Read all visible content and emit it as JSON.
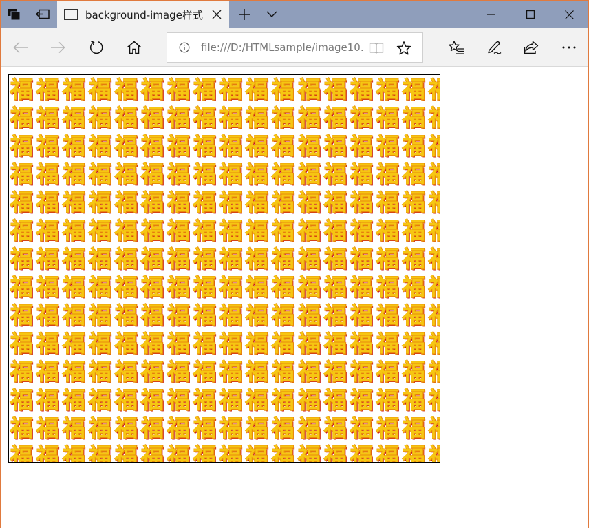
{
  "browser": {
    "tab_title": "background-image样式",
    "address": "file:///D:/HTMLsample/image10.",
    "buttons": {
      "back": "arrow-left-icon",
      "forward": "arrow-right-icon",
      "refresh": "refresh-icon",
      "home": "home-icon",
      "reading_view": "book-icon",
      "favorite": "star-icon",
      "favorites_hub": "favorites-list-icon",
      "pen": "pen-icon",
      "share": "share-icon",
      "more": "more-icon"
    },
    "window_controls": [
      "minimize-icon",
      "maximize-icon",
      "close-icon"
    ]
  },
  "content": {
    "tile_glyph": "福",
    "colors": {
      "tile_gold": "#f6c612",
      "tile_orange": "#e88a0c",
      "tile_red": "#c8161d",
      "box_border": "#000000",
      "frame": "#e07a3e",
      "tabbar": "#8f9ebb"
    }
  }
}
